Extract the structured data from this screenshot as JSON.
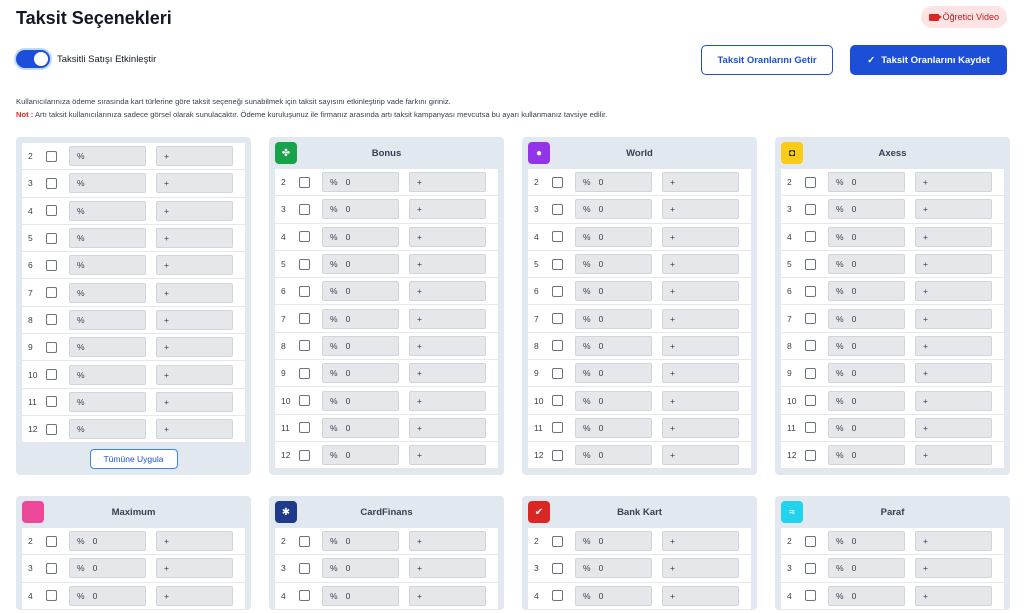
{
  "header": {
    "title": "Taksit Seçenekleri",
    "video_label": "Öğretici Video"
  },
  "toggle": {
    "label": "Taksitli Satışı Etkinleştir",
    "enabled": true
  },
  "actions": {
    "fetch_label": "Taksit Oranlarını Getir",
    "save_label": "Taksit Oranlarını Kaydet"
  },
  "description": {
    "line1": "Kullanıcılarınıza ödeme sırasında kart türlerine göre taksit seçeneği sunabilmek için taksit sayısını etkinleştirip vade farkını giriniz.",
    "note_label": "Not :",
    "note_text": " Artı taksit kullanıcılarınıza sadece görsel olarak sunulacaktır. Ödeme kuruluşunuz ile firmanız arasında artı taksit kampanyası mevcutsa bu ayarı kullanmanız tavsiye edilir."
  },
  "general": {
    "rows": [
      "2",
      "3",
      "4",
      "5",
      "6",
      "7",
      "8",
      "9",
      "10",
      "11",
      "12"
    ],
    "pct_symbol": "%",
    "plus_symbol": "+",
    "apply_label": "Tümüne Uygula"
  },
  "cards": [
    {
      "name": "Bonus",
      "logo": "clover-logo",
      "color": "#16a34a",
      "rows": [
        "2",
        "3",
        "4",
        "5",
        "6",
        "7",
        "8",
        "9",
        "10",
        "11",
        "12"
      ],
      "value": "0"
    },
    {
      "name": "World",
      "logo": "world-logo",
      "color": "#9333ea",
      "rows": [
        "2",
        "3",
        "4",
        "5",
        "6",
        "7",
        "8",
        "9",
        "10",
        "11",
        "12"
      ],
      "value": "0"
    },
    {
      "name": "Axess",
      "logo": "axess-logo",
      "color": "#facc15",
      "rows": [
        "2",
        "3",
        "4",
        "5",
        "6",
        "7",
        "8",
        "9",
        "10",
        "11",
        "12"
      ],
      "value": "0"
    },
    {
      "name": "Maximum",
      "logo": "maximum-logo",
      "color": "#ec4899",
      "rows": [
        "2",
        "3",
        "4"
      ],
      "value": "0"
    },
    {
      "name": "CardFinans",
      "logo": "cardfinans-logo",
      "color": "#1e3a8a",
      "rows": [
        "2",
        "3",
        "4"
      ],
      "value": "0"
    },
    {
      "name": "Bank Kart",
      "logo": "bankkart-logo",
      "color": "#dc2626",
      "rows": [
        "2",
        "3",
        "4"
      ],
      "value": "0"
    },
    {
      "name": "Paraf",
      "logo": "paraf-logo",
      "color": "#22d3ee",
      "rows": [
        "2",
        "3",
        "4"
      ],
      "value": "0"
    }
  ]
}
